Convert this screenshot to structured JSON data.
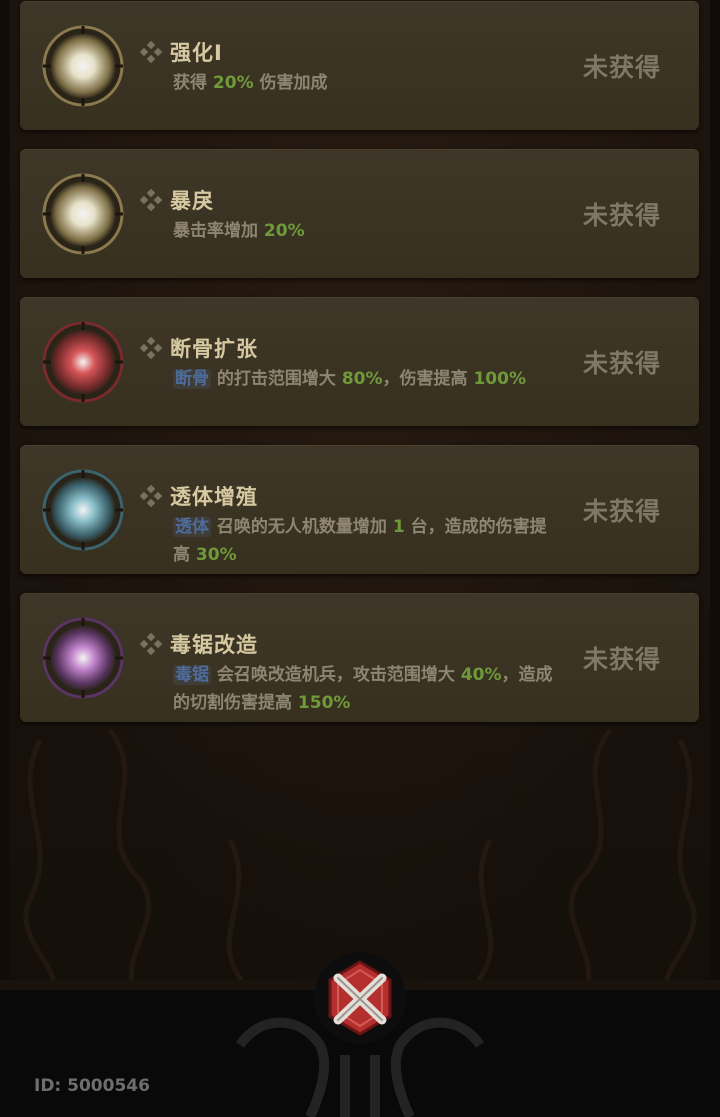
{
  "skills": [
    {
      "title": "强化I",
      "orb_color": "#f1ecd3",
      "orb_ring": "#8a7a4d",
      "parts": [
        {
          "text": "获得 ",
          "style": "plain"
        },
        {
          "text": "20%",
          "style": "green"
        },
        {
          "text": " 伤害加成",
          "style": "plain"
        }
      ],
      "status": "未获得"
    },
    {
      "title": "暴戾",
      "orb_color": "#f1ecd3",
      "orb_ring": "#8a7a4d",
      "parts": [
        {
          "text": "暴击率增加 ",
          "style": "plain"
        },
        {
          "text": "20%",
          "style": "green"
        }
      ],
      "status": "未获得"
    },
    {
      "title": "断骨扩张",
      "orb_color": "#e0585c",
      "orb_ring": "#7a2a2c",
      "parts": [
        {
          "text": "断骨",
          "style": "tag"
        },
        {
          "text": " 的打击范围增大 ",
          "style": "plain"
        },
        {
          "text": "80%",
          "style": "green"
        },
        {
          "text": "，伤害提高 ",
          "style": "plain"
        },
        {
          "text": "100%",
          "style": "green"
        }
      ],
      "status": "未获得"
    },
    {
      "title": "透体增殖",
      "orb_color": "#8fc7d4",
      "orb_ring": "#3a6470",
      "parts": [
        {
          "text": "透体",
          "style": "tag"
        },
        {
          "text": " 召唤的无人机数量增加 ",
          "style": "plain"
        },
        {
          "text": "1",
          "style": "green"
        },
        {
          "text": " 台，造成的伤害提高 ",
          "style": "plain"
        },
        {
          "text": "30%",
          "style": "green"
        }
      ],
      "status": "未获得"
    },
    {
      "title": "毒锯改造",
      "orb_color": "#c98ad6",
      "orb_ring": "#5a3464",
      "parts": [
        {
          "text": "毒锯",
          "style": "tag"
        },
        {
          "text": " 会召唤改造机兵，攻击范围增大 ",
          "style": "plain"
        },
        {
          "text": "40%",
          "style": "green"
        },
        {
          "text": "，造成的切割伤害提高 ",
          "style": "plain"
        },
        {
          "text": "150%",
          "style": "green"
        }
      ],
      "status": "未获得"
    }
  ],
  "footer": {
    "id_text": "ID: 5000546",
    "close_icon": "close-x-icon"
  },
  "colors": {
    "green": "#6f9a3a",
    "tag": "#4d6b9c",
    "title": "#d6c9a1",
    "status": "#7e7868"
  }
}
